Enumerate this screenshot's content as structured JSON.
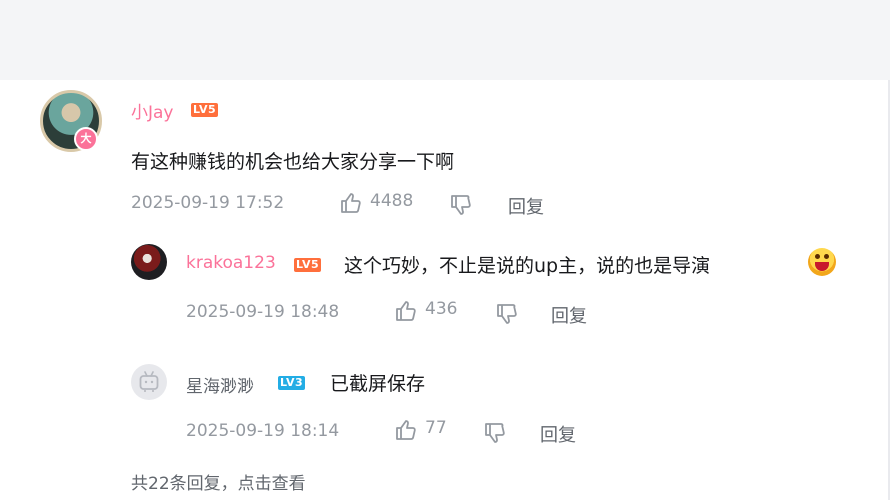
{
  "comment": {
    "username": "小Jay",
    "level": "LV5",
    "avatar_badge": "大",
    "text": "有这种赚钱的机会也给大家分享一下啊",
    "time": "2025-09-19 17:52",
    "likes": "4488",
    "reply_label": "回复"
  },
  "replies": [
    {
      "username": "krakoa123",
      "level": "LV5",
      "text": "这个巧妙，不止是说的up主，说的也是导演",
      "emoji": "angry-face-emoji",
      "time": "2025-09-19 18:48",
      "likes": "436",
      "reply_label": "回复"
    },
    {
      "username": "星海渺渺",
      "level": "LV3",
      "text": "已截屏保存",
      "time": "2025-09-19 18:14",
      "likes": "77",
      "reply_label": "回复"
    }
  ],
  "footer": "共22条回复，点击查看",
  "colors": {
    "vip_name": "#fb7299",
    "normal_name": "#61666d",
    "meta": "#9499a0",
    "level_orange": "#ff6f3c",
    "level_blue": "#23ade5"
  },
  "icons": [
    "thumbs-up-icon",
    "thumbs-down-icon",
    "bilibili-tv-icon"
  ]
}
